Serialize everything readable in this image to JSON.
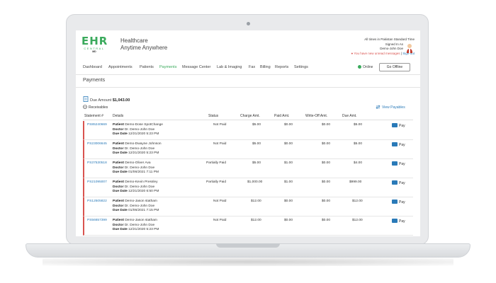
{
  "brand": {
    "logo_main": "EHR",
    "logo_sub": "CENTRAL",
    "logo_tag": "MD",
    "tagline_line1": "Healthcare",
    "tagline_line2": "Anytime Anywhere",
    "accent_color": "#3aaa5c"
  },
  "user": {
    "timezone_note": "All times in Pakistan Standard Time",
    "signed_in_as": "Signed In As",
    "name": "Demo-John Doe",
    "unread": "You have new unread messages",
    "separator": "|",
    "sign_out": "Sign-out"
  },
  "nav": {
    "items": [
      "Dashboard",
      "Appointments",
      "Patients",
      "Payments",
      "Message Center",
      "Lab & Imaging",
      "Fax",
      "Billing",
      "Reports",
      "Settings"
    ],
    "active": "Payments",
    "status": "Online",
    "go_offline": "Go Offline"
  },
  "page": {
    "title": "Payments",
    "due_label": "Due Amount",
    "due_value": "$1,043.00",
    "receivables": "Receivables",
    "view_payables": "View Payables"
  },
  "table": {
    "headers": [
      "Statement #",
      "Details",
      "Status",
      "Charge Amt.",
      "Paid Amt.",
      "Write-Off Amt.",
      "Due Amt."
    ],
    "labels": {
      "patient": "Patient",
      "doctor": "Doctor",
      "due_date": "Due Date",
      "pay": "Pay"
    },
    "rows": [
      {
        "statement": "PS85240669",
        "patient": "Demo-Dose SpotChange",
        "doctor": "Dr. Demo-John Doe",
        "due_date": "12/21/2020 5:23 PM",
        "status": "Not Paid",
        "charge": "$5.00",
        "paid": "$0.00",
        "writeoff": "$0.00",
        "due": "$5.00"
      },
      {
        "statement": "PS23006645",
        "patient": "Demo-Dwayne Johnson",
        "doctor": "Dr. Demo-John Doe",
        "due_date": "12/21/2020 5:23 PM",
        "status": "Not Paid",
        "charge": "$5.00",
        "paid": "$0.00",
        "writeoff": "$0.00",
        "due": "$5.00"
      },
      {
        "statement": "PS37530518",
        "patient": "Demo-Oliver Ava",
        "doctor": "Dr. Demo-John Doe",
        "due_date": "01/06/2021 7:11 PM",
        "status": "Partially Paid",
        "charge": "$5.00",
        "paid": "$1.00",
        "writeoff": "$0.00",
        "due": "$4.00"
      },
      {
        "statement": "PS21095007",
        "patient": "Demo-Kevin Pressley",
        "doctor": "Dr. Demo-John Doe",
        "due_date": "12/21/2020 6:50 PM",
        "status": "Partially Paid",
        "charge": "$1,000.00",
        "paid": "$1.00",
        "writeoff": "$0.00",
        "due": "$999.00"
      },
      {
        "statement": "PS12505822",
        "patient": "Demo-Jason statham",
        "doctor": "Dr. Demo-John Doe",
        "due_date": "01/06/2021 7:15 PM",
        "status": "Not Paid",
        "charge": "$12.00",
        "paid": "$0.00",
        "writeoff": "$0.00",
        "due": "$12.00"
      },
      {
        "statement": "PS56657399",
        "patient": "Demo-Jason statham",
        "doctor": "Dr. Demo-John Doe",
        "due_date": "12/21/2020 5:23 PM",
        "status": "Not Paid",
        "charge": "$12.00",
        "paid": "$0.00",
        "writeoff": "$0.00",
        "due": "$12.00"
      }
    ]
  },
  "icons": {
    "due": "document-money-icon",
    "receivables": "collapse-minus-icon",
    "payables": "swap-arrows-icon",
    "pay": "credit-card-icon"
  }
}
